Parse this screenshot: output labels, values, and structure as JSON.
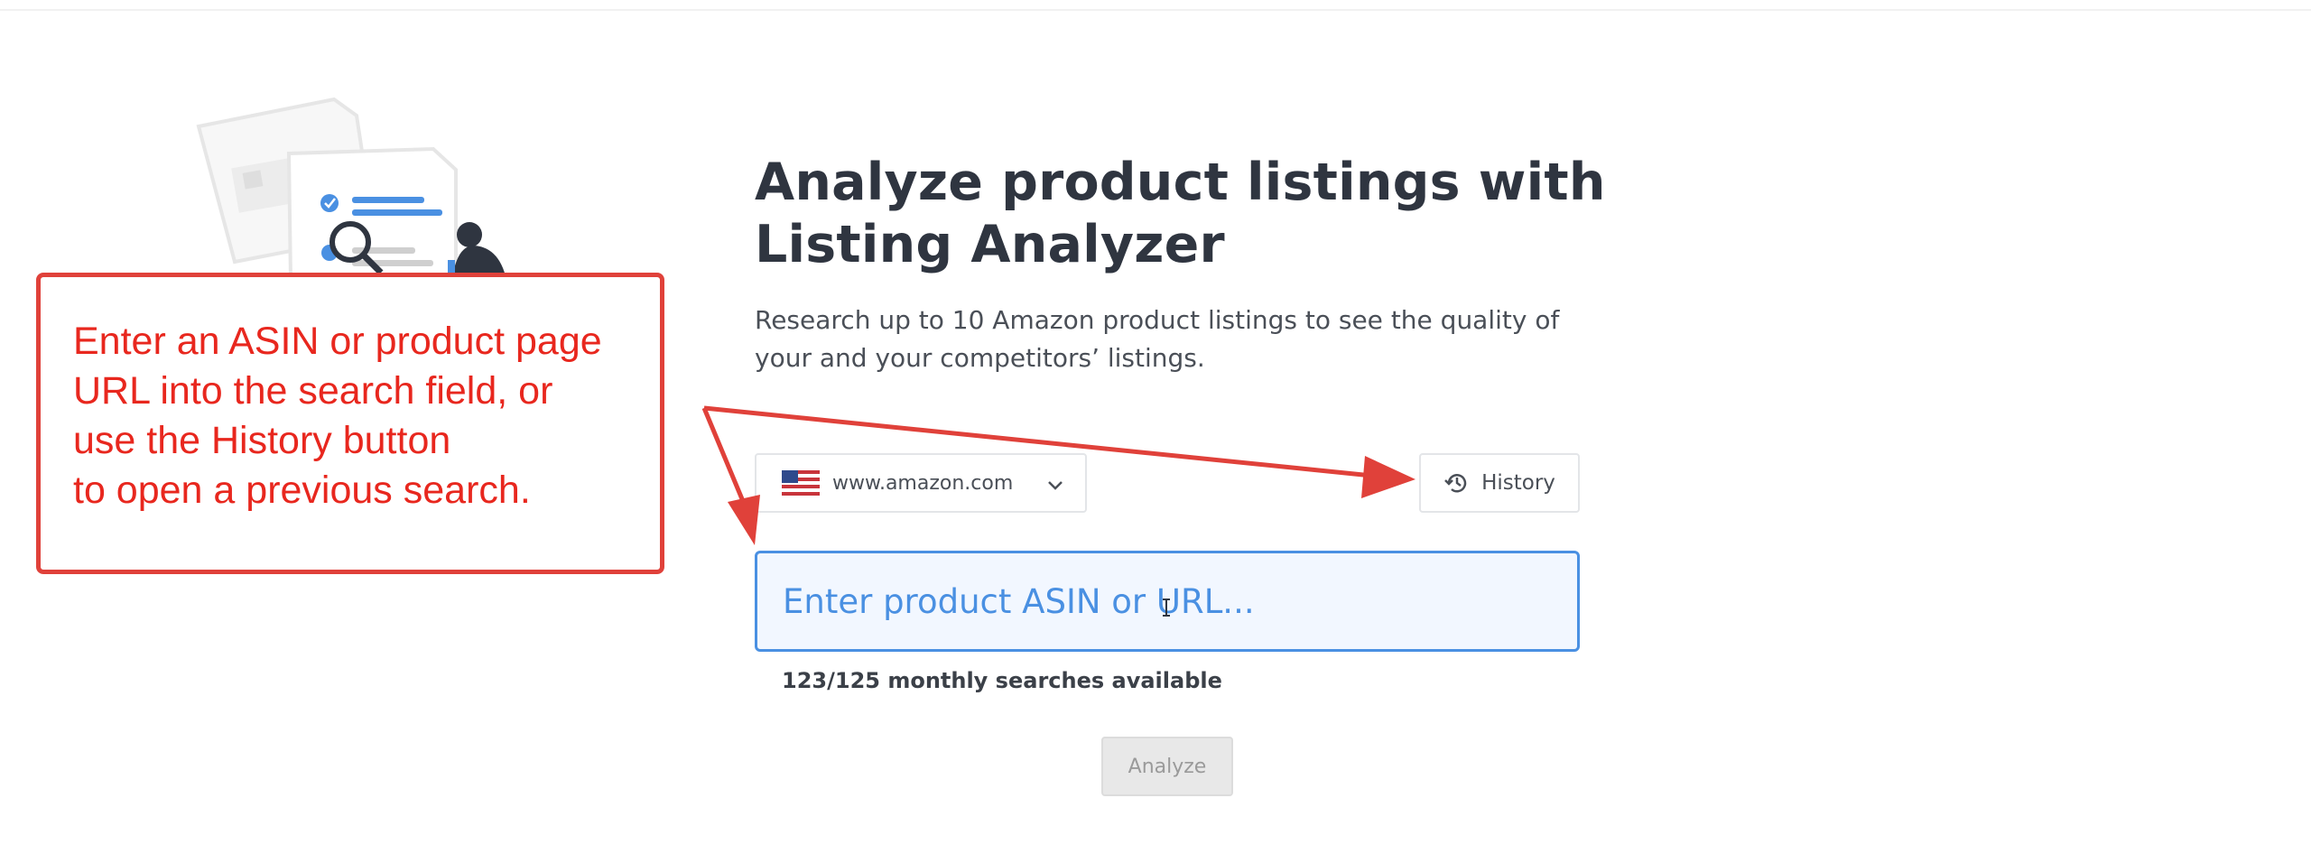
{
  "header": {
    "title": "Analyze product listings with Listing Analyzer",
    "subtitle": "Research up to 10 Amazon product listings to see the quality of your and your competitors’ listings."
  },
  "marketplace": {
    "selected": "www.amazon.com",
    "flag_icon": "us-flag-icon",
    "chevron_icon": "chevron-down-icon"
  },
  "history": {
    "label": "History",
    "icon": "history-icon"
  },
  "search": {
    "placeholder": "Enter product ASIN or URL...",
    "value": ""
  },
  "quota": {
    "text": "123/125 monthly searches available",
    "used": 123,
    "limit": 125
  },
  "analyze": {
    "label": "Analyze"
  },
  "callout": {
    "line1": "Enter an ASIN or product page",
    "line2": "URL into the search field, or",
    "line3": "use the History button",
    "line4": "to open a previous search."
  },
  "colors": {
    "accent": "#4a90e2",
    "annotation": "#e0413a",
    "heading": "#2f3540",
    "disabled_button": "#e8e8e8"
  }
}
